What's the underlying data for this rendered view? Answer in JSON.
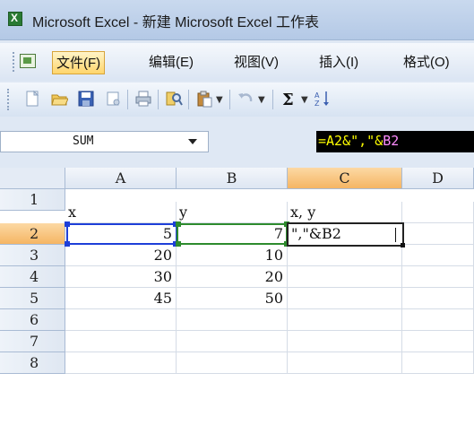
{
  "window": {
    "title": "Microsoft Excel - 新建 Microsoft Excel 工作表"
  },
  "menu": {
    "items": [
      "文件(F)",
      "编辑(E)",
      "视图(V)",
      "插入(I)",
      "格式(O)"
    ],
    "active_index": 0
  },
  "toolbar": {
    "buttons": [
      "new-icon",
      "open-icon",
      "save-icon",
      "permission-icon",
      "print-icon",
      "research-icon",
      "paste-icon",
      "undo-icon",
      "autosum-icon",
      "sort-ascending-icon"
    ]
  },
  "formula_bar": {
    "name_box": "SUM",
    "formula_prefix": "=A2&\",\"&",
    "formula_ref": "B2"
  },
  "sheet": {
    "columns": [
      "A",
      "B",
      "C",
      "D"
    ],
    "selected_column": "C",
    "rows": [
      "1",
      "2",
      "3",
      "4",
      "5",
      "6",
      "7",
      "8"
    ],
    "selected_row": "2",
    "cells": {
      "A1": "x",
      "B1": "y",
      "C1": "x, y",
      "A2": "5",
      "B2": "7",
      "C2": "\",\"&B2",
      "A3": "20",
      "B3": "10",
      "A4": "30",
      "B4": "20",
      "A5": "45",
      "B5": "50"
    },
    "reference_colors": {
      "A2": "#1e3fd8",
      "B2": "#2e8b2e"
    }
  }
}
